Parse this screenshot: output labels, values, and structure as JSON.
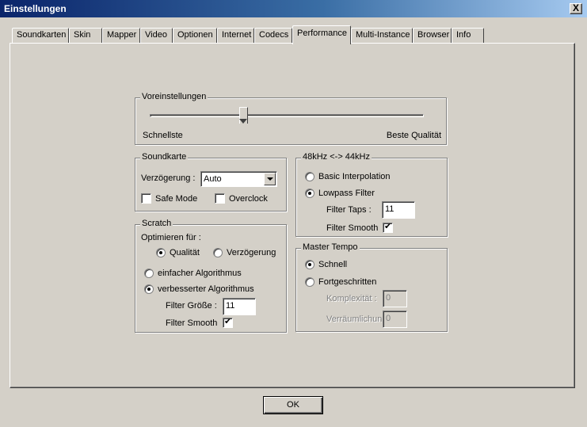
{
  "window": {
    "title": "Einstellungen",
    "close_glyph": "X"
  },
  "tabs": [
    {
      "label": "Soundkarten",
      "active": false
    },
    {
      "label": "Skin",
      "active": false
    },
    {
      "label": "Mapper",
      "active": false
    },
    {
      "label": "Video",
      "active": false
    },
    {
      "label": "Optionen",
      "active": false
    },
    {
      "label": "Internet",
      "active": false
    },
    {
      "label": "Codecs",
      "active": false
    },
    {
      "label": "Performance",
      "active": true
    },
    {
      "label": "Multi-Instance",
      "active": false
    },
    {
      "label": "Browser",
      "active": false
    },
    {
      "label": "Info",
      "active": false
    }
  ],
  "presets": {
    "title": "Voreinstellungen",
    "left_label": "Schnellste",
    "right_label": "Beste Qualität",
    "slider_position": 0.34
  },
  "soundcard": {
    "title": "Soundkarte",
    "latency_label": "Verzögerung :",
    "latency_value": "Auto",
    "safe_mode_label": "Safe Mode",
    "safe_mode_checked": false,
    "overclock_label": "Overclock",
    "overclock_checked": false
  },
  "scratch": {
    "title": "Scratch",
    "optimize_label": "Optimieren für :",
    "quality_label": "Qualität",
    "quality_selected": true,
    "latency_label": "Verzögerung",
    "latency_selected": false,
    "simple_algo_label": "einfacher Algorithmus",
    "simple_algo_selected": false,
    "improved_algo_label": "verbesserter Algorithmus",
    "improved_algo_selected": true,
    "filter_size_label": "Filter Größe :",
    "filter_size_value": "11",
    "filter_smooth_label": "Filter Smooth",
    "filter_smooth_checked": true
  },
  "resample": {
    "title": "48kHz <-> 44kHz",
    "basic_label": "Basic Interpolation",
    "basic_selected": false,
    "lowpass_label": "Lowpass Filter",
    "lowpass_selected": true,
    "taps_label": "Filter Taps :",
    "taps_value": "11",
    "smooth_label": "Filter Smooth",
    "smooth_checked": true
  },
  "master_tempo": {
    "title": "Master Tempo",
    "fast_label": "Schnell",
    "fast_selected": true,
    "advanced_label": "Fortgeschritten",
    "advanced_selected": false,
    "complexity_label": "Komplexität :",
    "complexity_value": "0",
    "spatial_label": "Verräumlichung",
    "spatial_value": "0"
  },
  "buttons": {
    "ok_label": "OK"
  }
}
